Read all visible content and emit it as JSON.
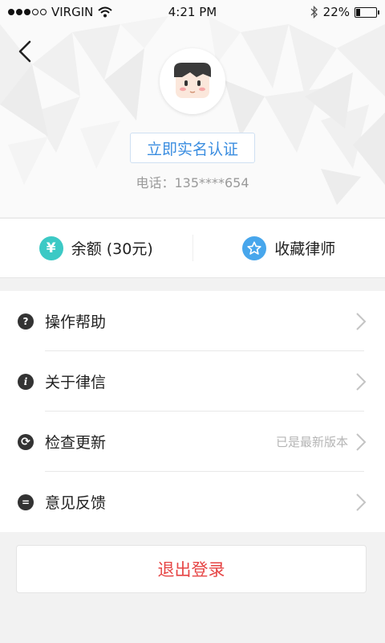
{
  "status_bar": {
    "carrier": "VIRGIN",
    "time": "4:21 PM",
    "battery": "22%",
    "battery_level": 0.22
  },
  "header": {
    "verify_label": "立即实名认证",
    "phone_text": "电话：135****654"
  },
  "quick": {
    "balance_icon": "¥",
    "balance_label": "余额 (30元)",
    "favorites_label": "收藏律师"
  },
  "menu": {
    "items": [
      {
        "label": "操作帮助",
        "value": "",
        "icon": "question-icon",
        "glyph": "?"
      },
      {
        "label": "关于律信",
        "value": "",
        "icon": "info-icon",
        "glyph": "i"
      },
      {
        "label": "检查更新",
        "value": "已是最新版本",
        "icon": "refresh-icon",
        "glyph": "⟳"
      },
      {
        "label": "意见反馈",
        "value": "",
        "icon": "feedback-icon",
        "glyph": "="
      }
    ]
  },
  "logout": {
    "label": "退出登录"
  },
  "colors": {
    "accent_blue": "#3a8de0",
    "balance_teal": "#3cc9c5",
    "favorites_blue": "#47a6ec",
    "logout_red": "#e64545"
  }
}
